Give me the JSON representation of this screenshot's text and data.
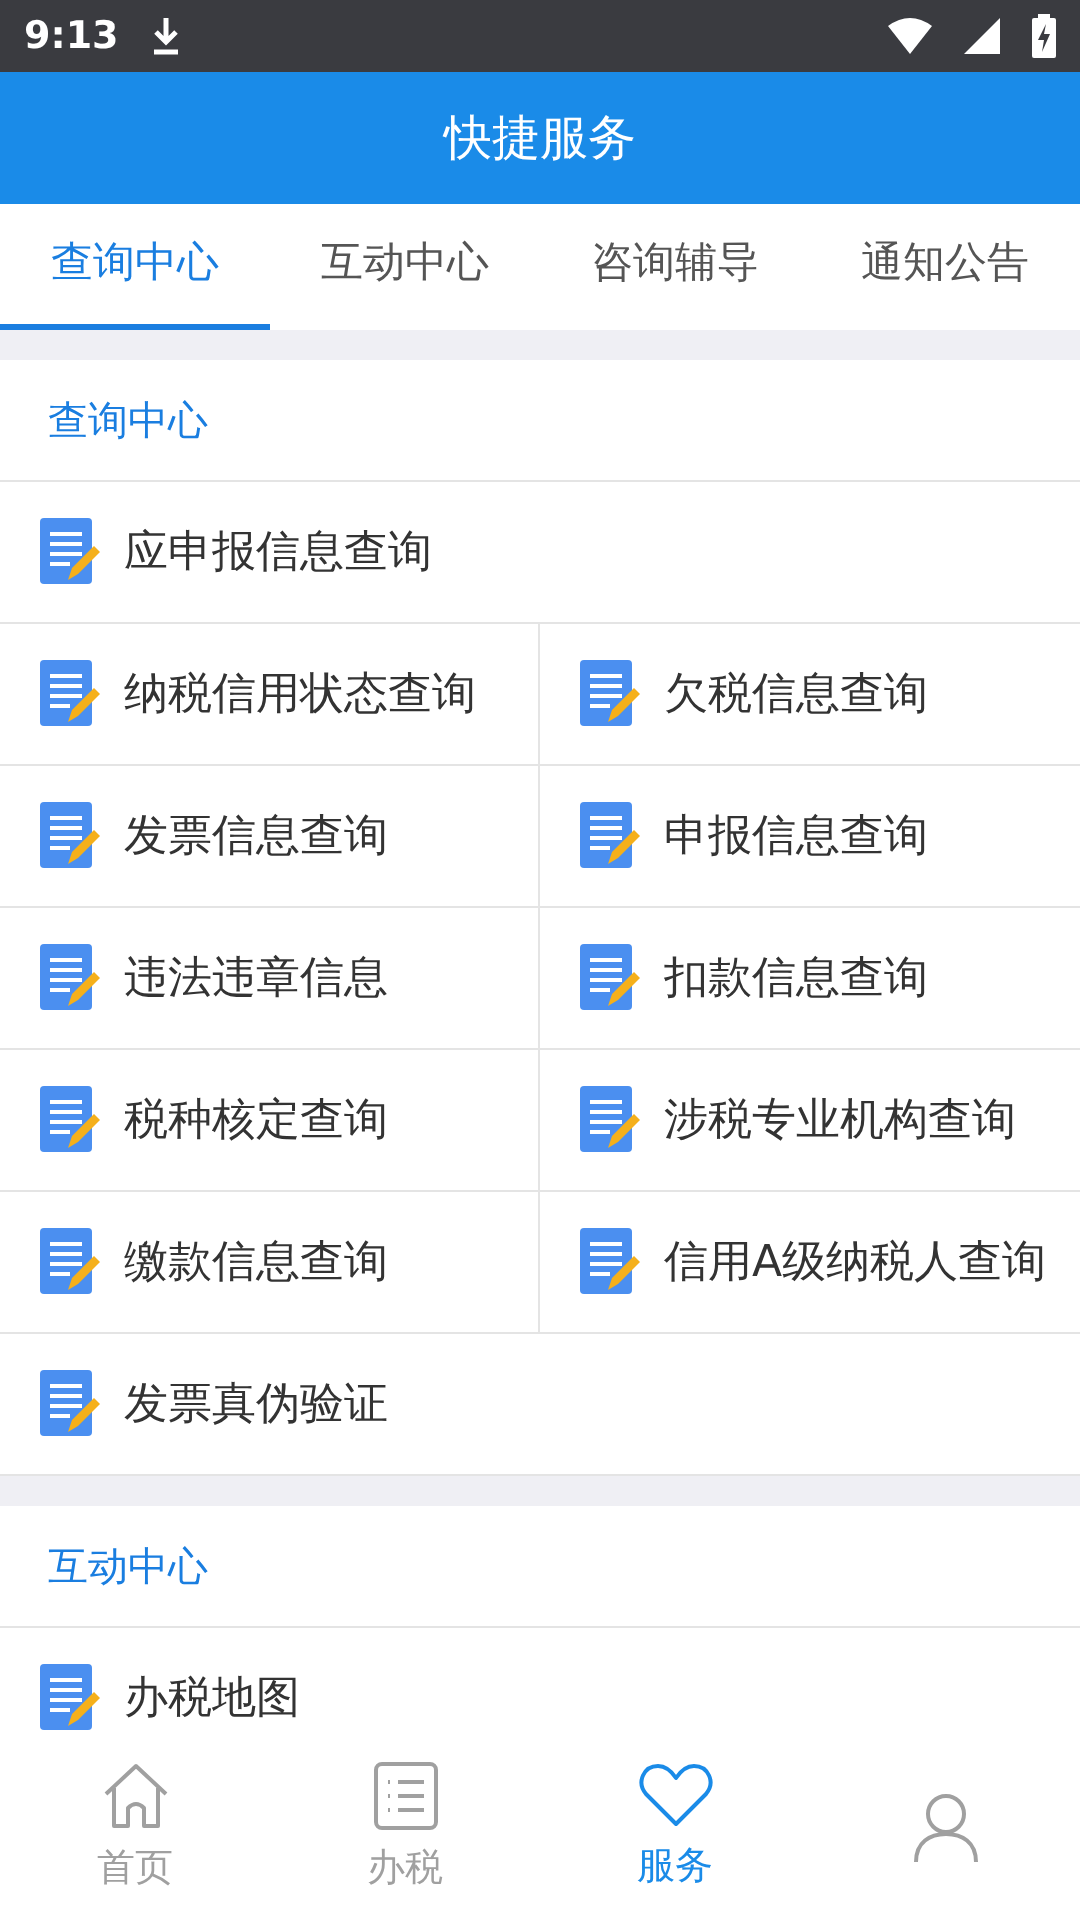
{
  "status_bar": {
    "time": "9:13"
  },
  "header": {
    "title": "快捷服务"
  },
  "tabs": [
    {
      "label": "查询中心",
      "selected": true
    },
    {
      "label": "互动中心",
      "selected": false
    },
    {
      "label": "咨询辅导",
      "selected": false
    },
    {
      "label": "通知公告",
      "selected": false
    }
  ],
  "sections": [
    {
      "title": "查询中心",
      "rows": [
        {
          "cells": [
            "应申报信息查询"
          ]
        },
        {
          "cells": [
            "纳税信用状态查询",
            "欠税信息查询"
          ]
        },
        {
          "cells": [
            "发票信息查询",
            "申报信息查询"
          ]
        },
        {
          "cells": [
            "违法违章信息",
            "扣款信息查询"
          ]
        },
        {
          "cells": [
            "税种核定查询",
            "涉税专业机构查询"
          ]
        },
        {
          "cells": [
            "缴款信息查询",
            "信用A级纳税人查询"
          ]
        },
        {
          "cells": [
            "发票真伪验证"
          ]
        }
      ]
    },
    {
      "title": "互动中心",
      "rows": [
        {
          "cells": [
            "办税地图"
          ]
        }
      ]
    }
  ],
  "bottom_nav": [
    {
      "kind": "home",
      "label": "首页",
      "selected": false
    },
    {
      "kind": "list",
      "label": "办税",
      "selected": false
    },
    {
      "kind": "heart",
      "label": "服务",
      "selected": true
    },
    {
      "kind": "person",
      "selected": false
    }
  ]
}
